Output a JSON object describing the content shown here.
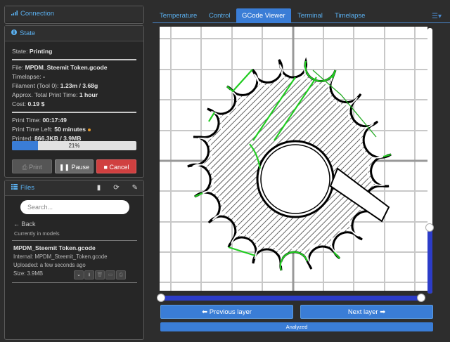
{
  "sidebar": {
    "connection": {
      "title": "Connection"
    },
    "state": {
      "title": "State",
      "state_label": "State:",
      "state_value": "Printing",
      "file_label": "File:",
      "file_value": "MPDM_Steemit Token.gcode",
      "timelapse_label": "Timelapse:",
      "timelapse_value": "-",
      "filament_label": "Filament (Tool 0):",
      "filament_value": "1.23m / 3.68g",
      "approx_label": "Approx. Total Print Time:",
      "approx_value": "1 hour",
      "cost_label": "Cost:",
      "cost_value": "0.19 $",
      "print_time_label": "Print Time:",
      "print_time_value": "00:17:49",
      "time_left_label": "Print Time Left:",
      "time_left_value": "50 minutes",
      "printed_label": "Printed:",
      "printed_value": "866.3KB / 3.9MB",
      "progress_percent": 21,
      "progress_text": "21%",
      "buttons": {
        "print": "Print",
        "pause": "Pause",
        "cancel": "Cancel"
      }
    },
    "files": {
      "title": "Files",
      "search_placeholder": "Search...",
      "back_label": "Back",
      "current_folder": "Currently in models",
      "items": [
        {
          "name": "MPDM_Steemit Token.gcode",
          "internal": "Internal: MPDM_Steemit_Token.gcode",
          "uploaded": "Uploaded: a few seconds ago",
          "size": "Size: 3.9MB"
        }
      ]
    }
  },
  "main": {
    "tabs": [
      "Temperature",
      "Control",
      "GCode Viewer",
      "Terminal",
      "Timelapse"
    ],
    "active_tab": "GCode Viewer",
    "prev_layer": "Previous layer",
    "next_layer": "Next layer",
    "analyzed": "Analyzed",
    "layer_slider_fraction": 0.25,
    "colors": {
      "accent": "#3a7dd6",
      "slider": "#2c3cc8",
      "cancel": "#d04040",
      "travel": "#22cc22"
    }
  }
}
